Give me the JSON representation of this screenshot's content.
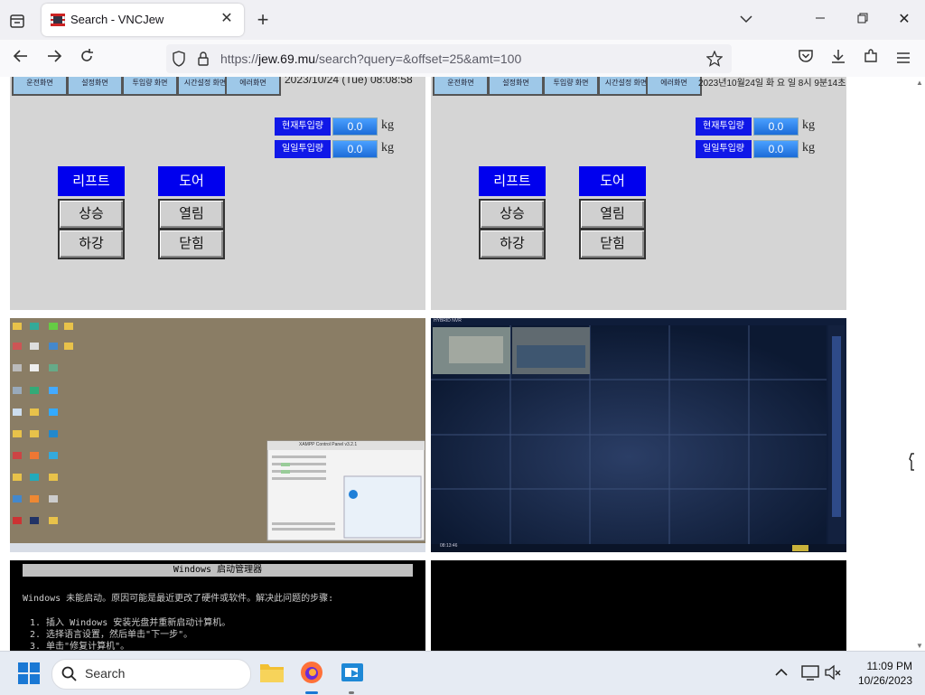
{
  "browser": {
    "tab_title": "Search - VNCJew",
    "url_prefix": "https://",
    "url_host": "jew.69.mu",
    "url_path": "/search?query=&offset=25&amt=100"
  },
  "thumbs": {
    "hmi_left": {
      "menu": [
        "운전화면",
        "설정화면",
        "투입량 화면",
        "시간설정 화면",
        "에러화면"
      ],
      "datetime": "2023/10/24 (Tue) 08:08:58",
      "current_label": "현재투입량",
      "current_value": "0.0",
      "daily_label": "일일투입량",
      "daily_value": "0.0",
      "unit": "kg",
      "lift": "리프트",
      "up": "상승",
      "down": "하강",
      "door": "도어",
      "open": "열림",
      "close": "닫힘"
    },
    "hmi_right": {
      "menu": [
        "운전화면",
        "설정화면",
        "투입량 화면",
        "시간설정 화면",
        "에러화면"
      ],
      "datetime": "2023년10월24일 화 요 일  8시  9분14초",
      "current_label": "현재투입량",
      "current_value": "0.0",
      "daily_label": "일일투입량",
      "daily_value": "0.0",
      "unit": "kg",
      "lift": "리프트",
      "up": "상승",
      "down": "하강",
      "door": "도어",
      "open": "열림",
      "close": "닫힘"
    },
    "desktop_window_title": "XAMPP Control Panel v3.2.1",
    "nvr_title": "HYBRID NVR",
    "nvr_time": "08:13:46",
    "boot": {
      "title": "Windows 启动管理器",
      "line1": "Windows 未能启动。原因可能是最近更改了硬件或软件。解决此问题的步骤:",
      "line2": "1. 插入 Windows 安装光盘并重新启动计算机。",
      "line3": "2. 选择语言设置，然后单击\"下一步\"。",
      "line4": "3. 单击\"修复计算机\"。"
    }
  },
  "taskbar": {
    "search_placeholder": "Search",
    "time": "11:09 PM",
    "date": "10/26/2023"
  },
  "colors": {
    "hmi_blue": "#1018e8",
    "taskbar_bg": "#e6ebf3",
    "nvr_bg": "#0f1d3a"
  }
}
